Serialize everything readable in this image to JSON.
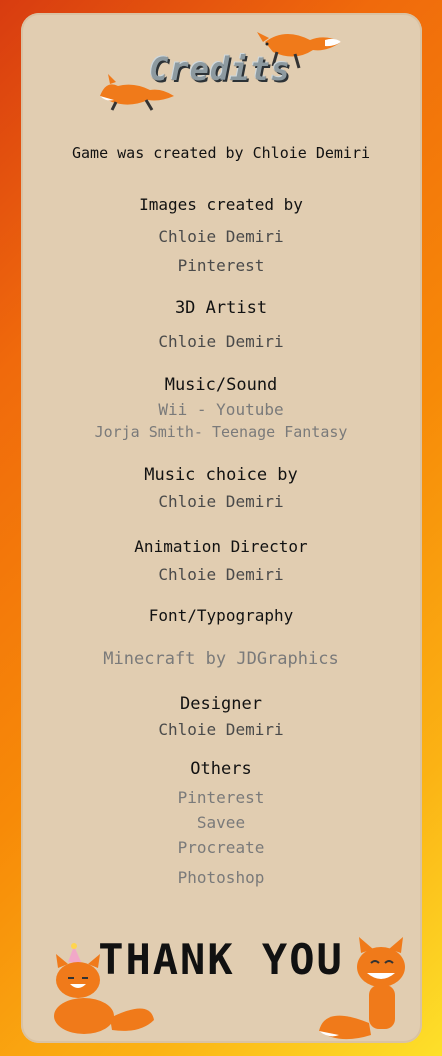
{
  "title": "Credits",
  "credits": {
    "created_line": "Game was created by   Chloie Demiri",
    "images_heading": "Images created by",
    "images_name_1": "Chloie Demiri",
    "images_name_2": "Pinterest",
    "artist_heading": "3D Artist",
    "artist_name": "Chloie Demiri",
    "music_heading": "Music/Sound",
    "music_item_1": "Wii - Youtube",
    "music_item_2": "Jorja Smith- Teenage Fantasy",
    "choice_heading": "Music choice by",
    "choice_name": "Chloie Demiri",
    "animation_heading": "Animation Director",
    "animation_name": "Chloie Demiri",
    "font_heading": "Font/Typography",
    "font_name": "Minecraft  by JDGraphics",
    "designer_heading": "Designer",
    "designer_name": "Chloie Demiri",
    "others_heading": "Others",
    "others_1": "Pinterest",
    "others_2": "Savee",
    "others_3": "Procreate",
    "others_4": "Photoshop"
  },
  "footer": {
    "thanks": "THANK YOU"
  },
  "colors": {
    "panel": "#e1cdb1",
    "border_top": "#d83c10",
    "border_bottom": "#fde02a",
    "fox": "#f07a1a"
  }
}
